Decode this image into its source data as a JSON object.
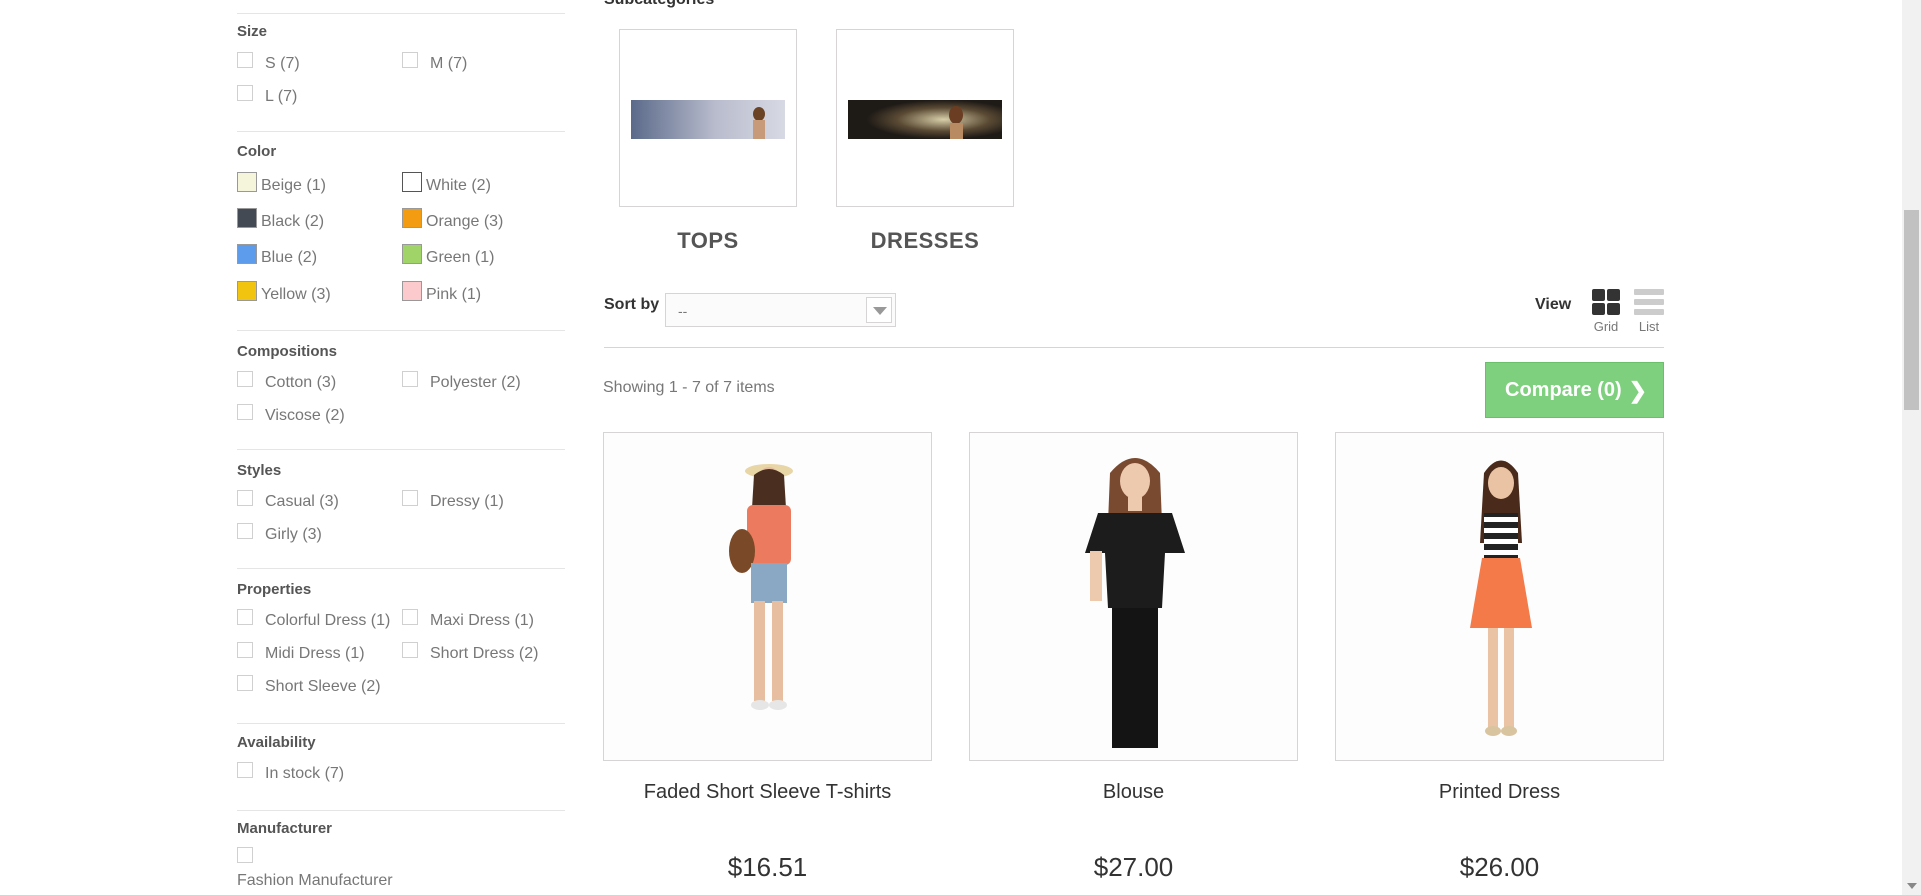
{
  "filters": {
    "size": {
      "title": "Size",
      "options": [
        "S (7)",
        "M (7)",
        "L (7)"
      ]
    },
    "color": {
      "title": "Color",
      "options": [
        {
          "label": "Beige (1)",
          "color": "#f5f5dc"
        },
        {
          "label": "White (2)",
          "color": "#ffffff"
        },
        {
          "label": "Black (2)",
          "color": "#434a54"
        },
        {
          "label": "Orange (3)",
          "color": "#f39c11"
        },
        {
          "label": "Blue (2)",
          "color": "#5d9cec"
        },
        {
          "label": "Green (1)",
          "color": "#a0d468"
        },
        {
          "label": "Yellow (3)",
          "color": "#f1c40f"
        },
        {
          "label": "Pink (1)",
          "color": "#fccacd"
        }
      ]
    },
    "compositions": {
      "title": "Compositions",
      "options": [
        "Cotton (3)",
        "Polyester (2)",
        "Viscose (2)"
      ]
    },
    "styles": {
      "title": "Styles",
      "options": [
        "Casual (3)",
        "Dressy (1)",
        "Girly (3)"
      ]
    },
    "properties": {
      "title": "Properties",
      "options": [
        "Colorful Dress (1)",
        "Maxi Dress (1)",
        "Midi Dress (1)",
        "Short Dress (2)",
        "Short Sleeve (2)"
      ]
    },
    "availability": {
      "title": "Availability",
      "options": [
        "In stock (7)"
      ]
    },
    "manufacturer": {
      "title": "Manufacturer",
      "options": [
        "Fashion Manufacturer"
      ]
    }
  },
  "subcategories": {
    "title": "Subcategories",
    "items": [
      {
        "name": "TOPS"
      },
      {
        "name": "DRESSES"
      }
    ]
  },
  "toolbar": {
    "sort_label": "Sort by",
    "sort_value": "--",
    "view_label": "View",
    "grid_label": "Grid",
    "list_label": "List",
    "showing": "Showing 1 - 7 of 7 items",
    "compare_label": "Compare (0)"
  },
  "products": [
    {
      "name": "Faded Short Sleeve T-shirts",
      "price": "$16.51"
    },
    {
      "name": "Blouse",
      "price": "$27.00"
    },
    {
      "name": "Printed Dress",
      "price": "$26.00"
    }
  ]
}
